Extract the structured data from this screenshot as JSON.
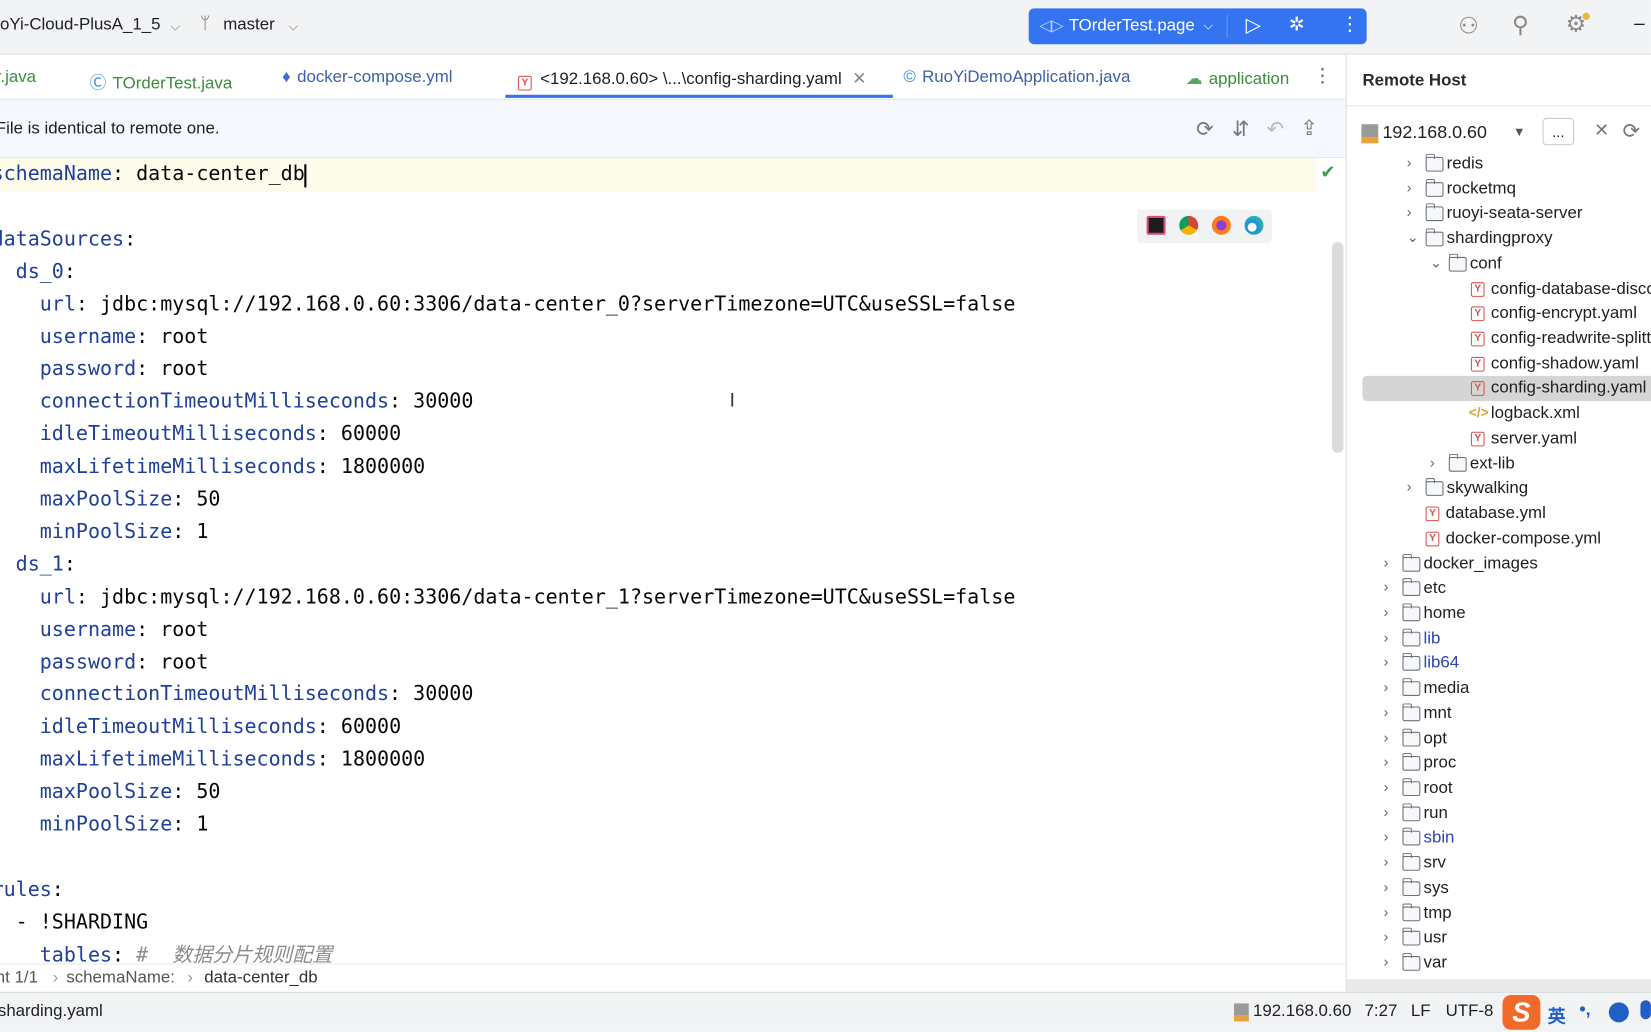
{
  "topbar": {
    "project": "oYi-Cloud-PlusA_1_5",
    "branch": "master",
    "run_config": "TOrderTest.page",
    "minimize": "–"
  },
  "tabs": [
    {
      "label": "r.java",
      "color": "#3b8d3b"
    },
    {
      "label": "TOrderTest.java",
      "color": "#3b8d3b"
    },
    {
      "label": "docker-compose.yml",
      "color": "#3d5fa8"
    },
    {
      "label": "<192.168.0.60> \\...\\config-sharding.yaml",
      "color": "#1e1f22",
      "active": true
    },
    {
      "label": "RuoYiDemoApplication.java",
      "color": "#3d5fa8"
    },
    {
      "label": "application",
      "color": "#3b8d3b"
    }
  ],
  "accent": "#3574f0",
  "notification": {
    "text": "File is identical to remote one."
  },
  "code_lines": [
    {
      "indent": 0,
      "key": "schemaName",
      "value": " data-center_db"
    },
    {
      "indent": 0,
      "key": "",
      "value": ""
    },
    {
      "indent": 0,
      "key": "dataSources",
      "value": ""
    },
    {
      "indent": 2,
      "key": "ds_0",
      "value": ""
    },
    {
      "indent": 4,
      "key": "url",
      "value": " jdbc:mysql://192.168.0.60:3306/data-center_0?serverTimezone=UTC&useSSL=false"
    },
    {
      "indent": 4,
      "key": "username",
      "value": " root"
    },
    {
      "indent": 4,
      "key": "password",
      "value": " root"
    },
    {
      "indent": 4,
      "key": "connectionTimeoutMilliseconds",
      "value": " 30000"
    },
    {
      "indent": 4,
      "key": "idleTimeoutMilliseconds",
      "value": " 60000"
    },
    {
      "indent": 4,
      "key": "maxLifetimeMilliseconds",
      "value": " 1800000"
    },
    {
      "indent": 4,
      "key": "maxPoolSize",
      "value": " 50"
    },
    {
      "indent": 4,
      "key": "minPoolSize",
      "value": " 1"
    },
    {
      "indent": 2,
      "key": "ds_1",
      "value": ""
    },
    {
      "indent": 4,
      "key": "url",
      "value": " jdbc:mysql://192.168.0.60:3306/data-center_1?serverTimezone=UTC&useSSL=false"
    },
    {
      "indent": 4,
      "key": "username",
      "value": " root"
    },
    {
      "indent": 4,
      "key": "password",
      "value": " root"
    },
    {
      "indent": 4,
      "key": "connectionTimeoutMilliseconds",
      "value": " 30000"
    },
    {
      "indent": 4,
      "key": "idleTimeoutMilliseconds",
      "value": " 60000"
    },
    {
      "indent": 4,
      "key": "maxLifetimeMilliseconds",
      "value": " 1800000"
    },
    {
      "indent": 4,
      "key": "maxPoolSize",
      "value": " 50"
    },
    {
      "indent": 4,
      "key": "minPoolSize",
      "value": " 1"
    },
    {
      "indent": 0,
      "key": "",
      "value": ""
    },
    {
      "indent": 0,
      "key": "rules",
      "value": ""
    },
    {
      "indent": 2,
      "key": "",
      "value": "- !SHARDING"
    },
    {
      "indent": 4,
      "key": "tables",
      "value": " ",
      "comment": "#  数据分片规则配置"
    }
  ],
  "breadcrumb": [
    "nt 1/1",
    "schemaName:",
    "data-center_db"
  ],
  "remote_host": {
    "title": "Remote Host",
    "host": "192.168.0.60",
    "more": "..."
  },
  "tree": [
    {
      "label": "redis",
      "level": 1,
      "type": "folder",
      "expanded": false
    },
    {
      "label": "rocketmq",
      "level": 1,
      "type": "folder",
      "expanded": false
    },
    {
      "label": "ruoyi-seata-server",
      "level": 1,
      "type": "folder",
      "expanded": false
    },
    {
      "label": "shardingproxy",
      "level": 1,
      "type": "folder",
      "expanded": true
    },
    {
      "label": "conf",
      "level": 2,
      "type": "folder",
      "expanded": true
    },
    {
      "label": "config-database-discovery.yaml",
      "level": 3,
      "type": "yaml"
    },
    {
      "label": "config-encrypt.yaml",
      "level": 3,
      "type": "yaml"
    },
    {
      "label": "config-readwrite-splitting.yaml",
      "level": 3,
      "type": "yaml"
    },
    {
      "label": "config-shadow.yaml",
      "level": 3,
      "type": "yaml"
    },
    {
      "label": "config-sharding.yaml",
      "level": 3,
      "type": "yaml",
      "selected": true
    },
    {
      "label": "logback.xml",
      "level": 3,
      "type": "xml"
    },
    {
      "label": "server.yaml",
      "level": 3,
      "type": "yaml"
    },
    {
      "label": "ext-lib",
      "level": 2,
      "type": "folder",
      "expanded": false
    },
    {
      "label": "skywalking",
      "level": 1,
      "type": "folder",
      "expanded": false
    },
    {
      "label": "database.yml",
      "level": 1,
      "type": "yaml",
      "file": true
    },
    {
      "label": "docker-compose.yml",
      "level": 1,
      "type": "yaml",
      "file": true
    },
    {
      "label": "docker_images",
      "level": 0,
      "type": "folder",
      "expanded": false
    },
    {
      "label": "etc",
      "level": 0,
      "type": "folder",
      "expanded": false
    },
    {
      "label": "home",
      "level": 0,
      "type": "folder",
      "expanded": false
    },
    {
      "label": "lib",
      "level": 0,
      "type": "folder",
      "expanded": false,
      "link": true
    },
    {
      "label": "lib64",
      "level": 0,
      "type": "folder",
      "expanded": false,
      "link": true
    },
    {
      "label": "media",
      "level": 0,
      "type": "folder",
      "expanded": false
    },
    {
      "label": "mnt",
      "level": 0,
      "type": "folder",
      "expanded": false
    },
    {
      "label": "opt",
      "level": 0,
      "type": "folder",
      "expanded": false
    },
    {
      "label": "proc",
      "level": 0,
      "type": "folder",
      "expanded": false
    },
    {
      "label": "root",
      "level": 0,
      "type": "folder",
      "expanded": false
    },
    {
      "label": "run",
      "level": 0,
      "type": "folder",
      "expanded": false
    },
    {
      "label": "sbin",
      "level": 0,
      "type": "folder",
      "expanded": false,
      "link": true
    },
    {
      "label": "srv",
      "level": 0,
      "type": "folder",
      "expanded": false
    },
    {
      "label": "sys",
      "level": 0,
      "type": "folder",
      "expanded": false
    },
    {
      "label": "tmp",
      "level": 0,
      "type": "folder",
      "expanded": false
    },
    {
      "label": "usr",
      "level": 0,
      "type": "folder",
      "expanded": false
    },
    {
      "label": "var",
      "level": 0,
      "type": "folder",
      "expanded": false
    }
  ],
  "status": {
    "file": "sharding.yaml",
    "host": "192.168.0.60",
    "position": "7:27",
    "line_sep": "LF",
    "encoding": "UTF-8",
    "ime_lang": "英",
    "ime_punct": "•,"
  }
}
